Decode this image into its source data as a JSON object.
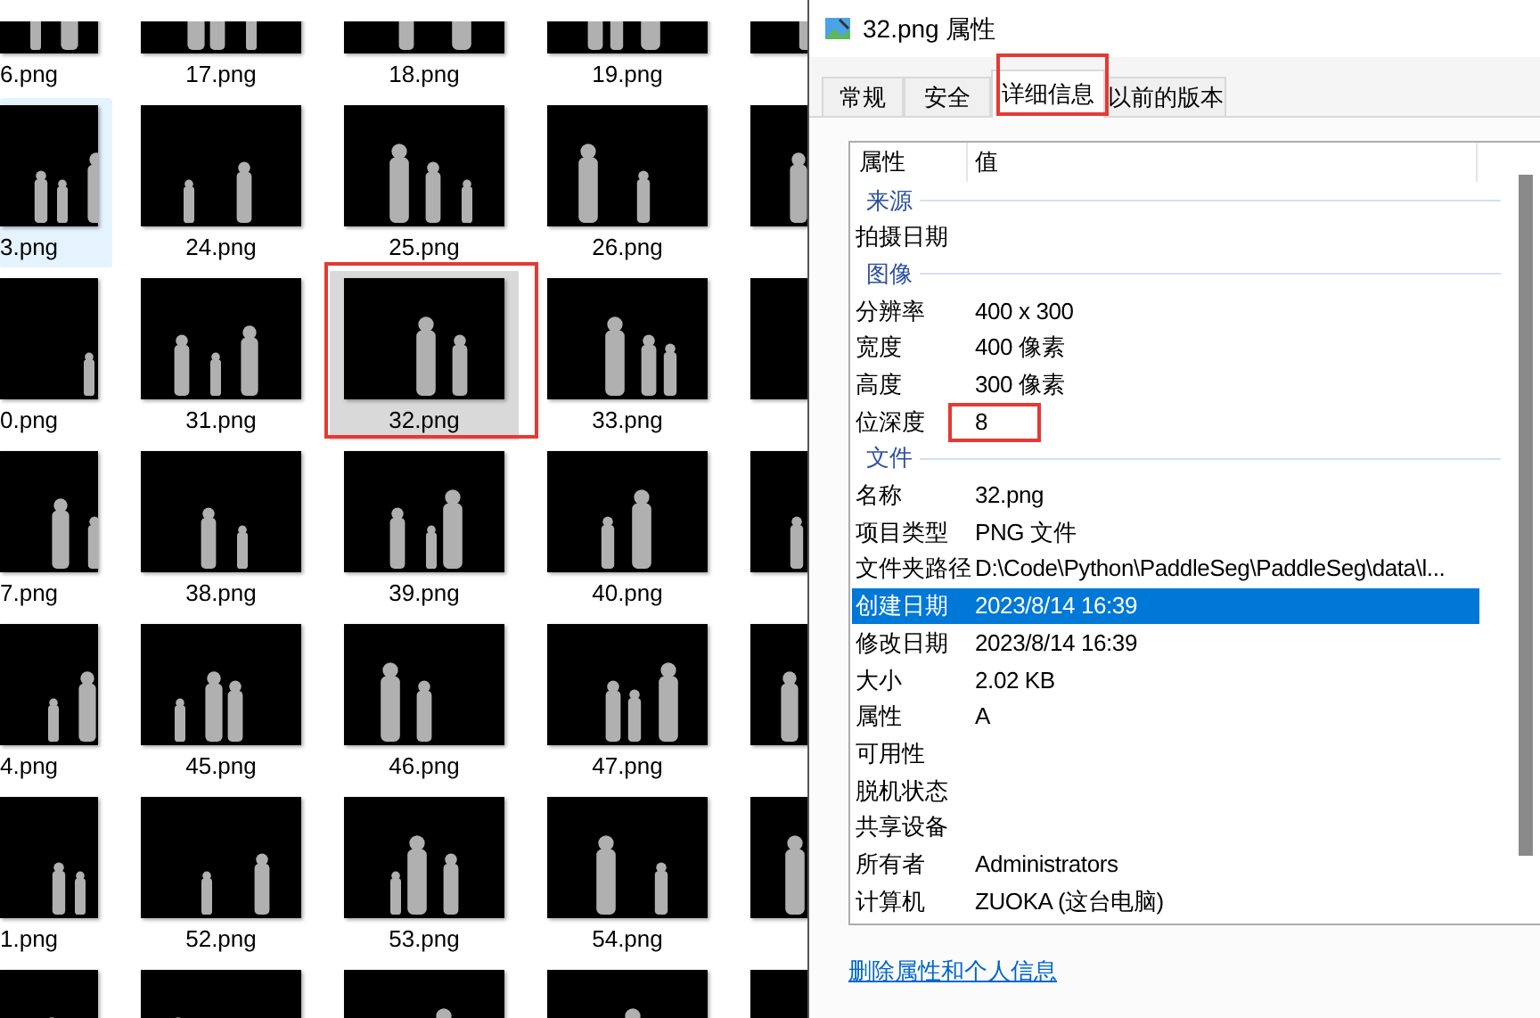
{
  "explorer": {
    "rows": [
      [
        {
          "label": "6.png",
          "selected": false,
          "hovered": false,
          "annotated": false
        },
        {
          "label": "17.png",
          "selected": false,
          "hovered": false,
          "annotated": false
        },
        {
          "label": "18.png",
          "selected": false,
          "hovered": false,
          "annotated": false
        },
        {
          "label": "19.png",
          "selected": false,
          "hovered": false,
          "annotated": false
        },
        {
          "selected": false,
          "hovered": false,
          "annotated": false
        }
      ],
      [
        {
          "label": "3.png",
          "selected": false,
          "hovered": true,
          "annotated": false
        },
        {
          "label": "24.png",
          "selected": false,
          "hovered": false,
          "annotated": false
        },
        {
          "label": "25.png",
          "selected": false,
          "hovered": false,
          "annotated": false
        },
        {
          "label": "26.png",
          "selected": false,
          "hovered": false,
          "annotated": false
        },
        {
          "selected": false,
          "hovered": false,
          "annotated": false
        }
      ],
      [
        {
          "label": "0.png",
          "selected": false,
          "hovered": false,
          "annotated": false
        },
        {
          "label": "31.png",
          "selected": false,
          "hovered": false,
          "annotated": false
        },
        {
          "label": "32.png",
          "selected": true,
          "hovered": false,
          "annotated": true
        },
        {
          "label": "33.png",
          "selected": false,
          "hovered": false,
          "annotated": false
        },
        {
          "selected": false,
          "hovered": false,
          "annotated": false
        }
      ],
      [
        {
          "label": "7.png",
          "selected": false,
          "hovered": false,
          "annotated": false
        },
        {
          "label": "38.png",
          "selected": false,
          "hovered": false,
          "annotated": false
        },
        {
          "label": "39.png",
          "selected": false,
          "hovered": false,
          "annotated": false
        },
        {
          "label": "40.png",
          "selected": false,
          "hovered": false,
          "annotated": false
        },
        {
          "selected": false,
          "hovered": false,
          "annotated": false
        }
      ],
      [
        {
          "label": "4.png",
          "selected": false,
          "hovered": false,
          "annotated": false
        },
        {
          "label": "45.png",
          "selected": false,
          "hovered": false,
          "annotated": false
        },
        {
          "label": "46.png",
          "selected": false,
          "hovered": false,
          "annotated": false
        },
        {
          "label": "47.png",
          "selected": false,
          "hovered": false,
          "annotated": false
        },
        {
          "selected": false,
          "hovered": false,
          "annotated": false
        }
      ],
      [
        {
          "label": "1.png",
          "selected": false,
          "hovered": false,
          "annotated": false
        },
        {
          "label": "52.png",
          "selected": false,
          "hovered": false,
          "annotated": false
        },
        {
          "label": "53.png",
          "selected": false,
          "hovered": false,
          "annotated": false
        },
        {
          "label": "54.png",
          "selected": false,
          "hovered": false,
          "annotated": false
        },
        {
          "selected": false,
          "hovered": false,
          "annotated": false
        }
      ],
      [
        {
          "selected": false,
          "hovered": false,
          "annotated": false
        },
        {
          "selected": false,
          "hovered": false,
          "annotated": false
        },
        {
          "selected": false,
          "hovered": false,
          "annotated": false
        },
        {
          "selected": false,
          "hovered": false,
          "annotated": false
        },
        {
          "selected": false,
          "hovered": false,
          "annotated": false
        }
      ]
    ]
  },
  "dialog": {
    "title": "32.png 属性",
    "tabs": [
      {
        "label": "常规",
        "selected": false,
        "annotated": false
      },
      {
        "label": "安全",
        "selected": false,
        "annotated": false
      },
      {
        "label": "详细信息",
        "selected": true,
        "annotated": true
      },
      {
        "label": "以前的版本",
        "selected": false,
        "annotated": false
      }
    ],
    "details": {
      "columns": [
        "属性",
        "值"
      ],
      "rows": [
        {
          "kind": "group",
          "label": "来源"
        },
        {
          "kind": "property",
          "name": "拍摄日期",
          "selected": false,
          "annotated": false
        },
        {
          "kind": "group",
          "label": "图像"
        },
        {
          "kind": "property",
          "name": "分辨率",
          "value": "400 x 300",
          "selected": false,
          "annotated": false
        },
        {
          "kind": "property",
          "name": "宽度",
          "value": "400 像素",
          "selected": false,
          "annotated": false
        },
        {
          "kind": "property",
          "name": "高度",
          "value": "300 像素",
          "selected": false,
          "annotated": false
        },
        {
          "kind": "property",
          "name": "位深度",
          "value": "8",
          "selected": false,
          "annotated": true
        },
        {
          "kind": "group",
          "label": "文件"
        },
        {
          "kind": "property",
          "name": "名称",
          "value": "32.png",
          "selected": false,
          "annotated": false
        },
        {
          "kind": "property",
          "name": "项目类型",
          "value": "PNG 文件",
          "selected": false,
          "annotated": false
        },
        {
          "kind": "property",
          "name": "文件夹路径",
          "value": "D:\\Code\\Python\\PaddleSeg\\PaddleSeg\\data\\l...",
          "selected": false,
          "annotated": false
        },
        {
          "kind": "property",
          "name": "创建日期",
          "value": "2023/8/14 16:39",
          "selected": true,
          "annotated": false
        },
        {
          "kind": "property",
          "name": "修改日期",
          "value": "2023/8/14 16:39",
          "selected": false,
          "annotated": false
        },
        {
          "kind": "property",
          "name": "大小",
          "value": "2.02 KB",
          "selected": false,
          "annotated": false
        },
        {
          "kind": "property",
          "name": "属性",
          "value": "A",
          "selected": false,
          "annotated": false
        },
        {
          "kind": "property",
          "name": "可用性",
          "selected": false,
          "annotated": false
        },
        {
          "kind": "property",
          "name": "脱机状态",
          "selected": false,
          "annotated": false
        },
        {
          "kind": "property",
          "name": "共享设备",
          "selected": false,
          "annotated": false
        },
        {
          "kind": "property",
          "name": "所有者",
          "value": "Administrators",
          "selected": false,
          "annotated": false
        },
        {
          "kind": "property",
          "name": "计算机",
          "value": "ZUOKA (这台电脑)",
          "selected": false,
          "annotated": false
        }
      ]
    },
    "link": "删除属性和个人信息"
  }
}
